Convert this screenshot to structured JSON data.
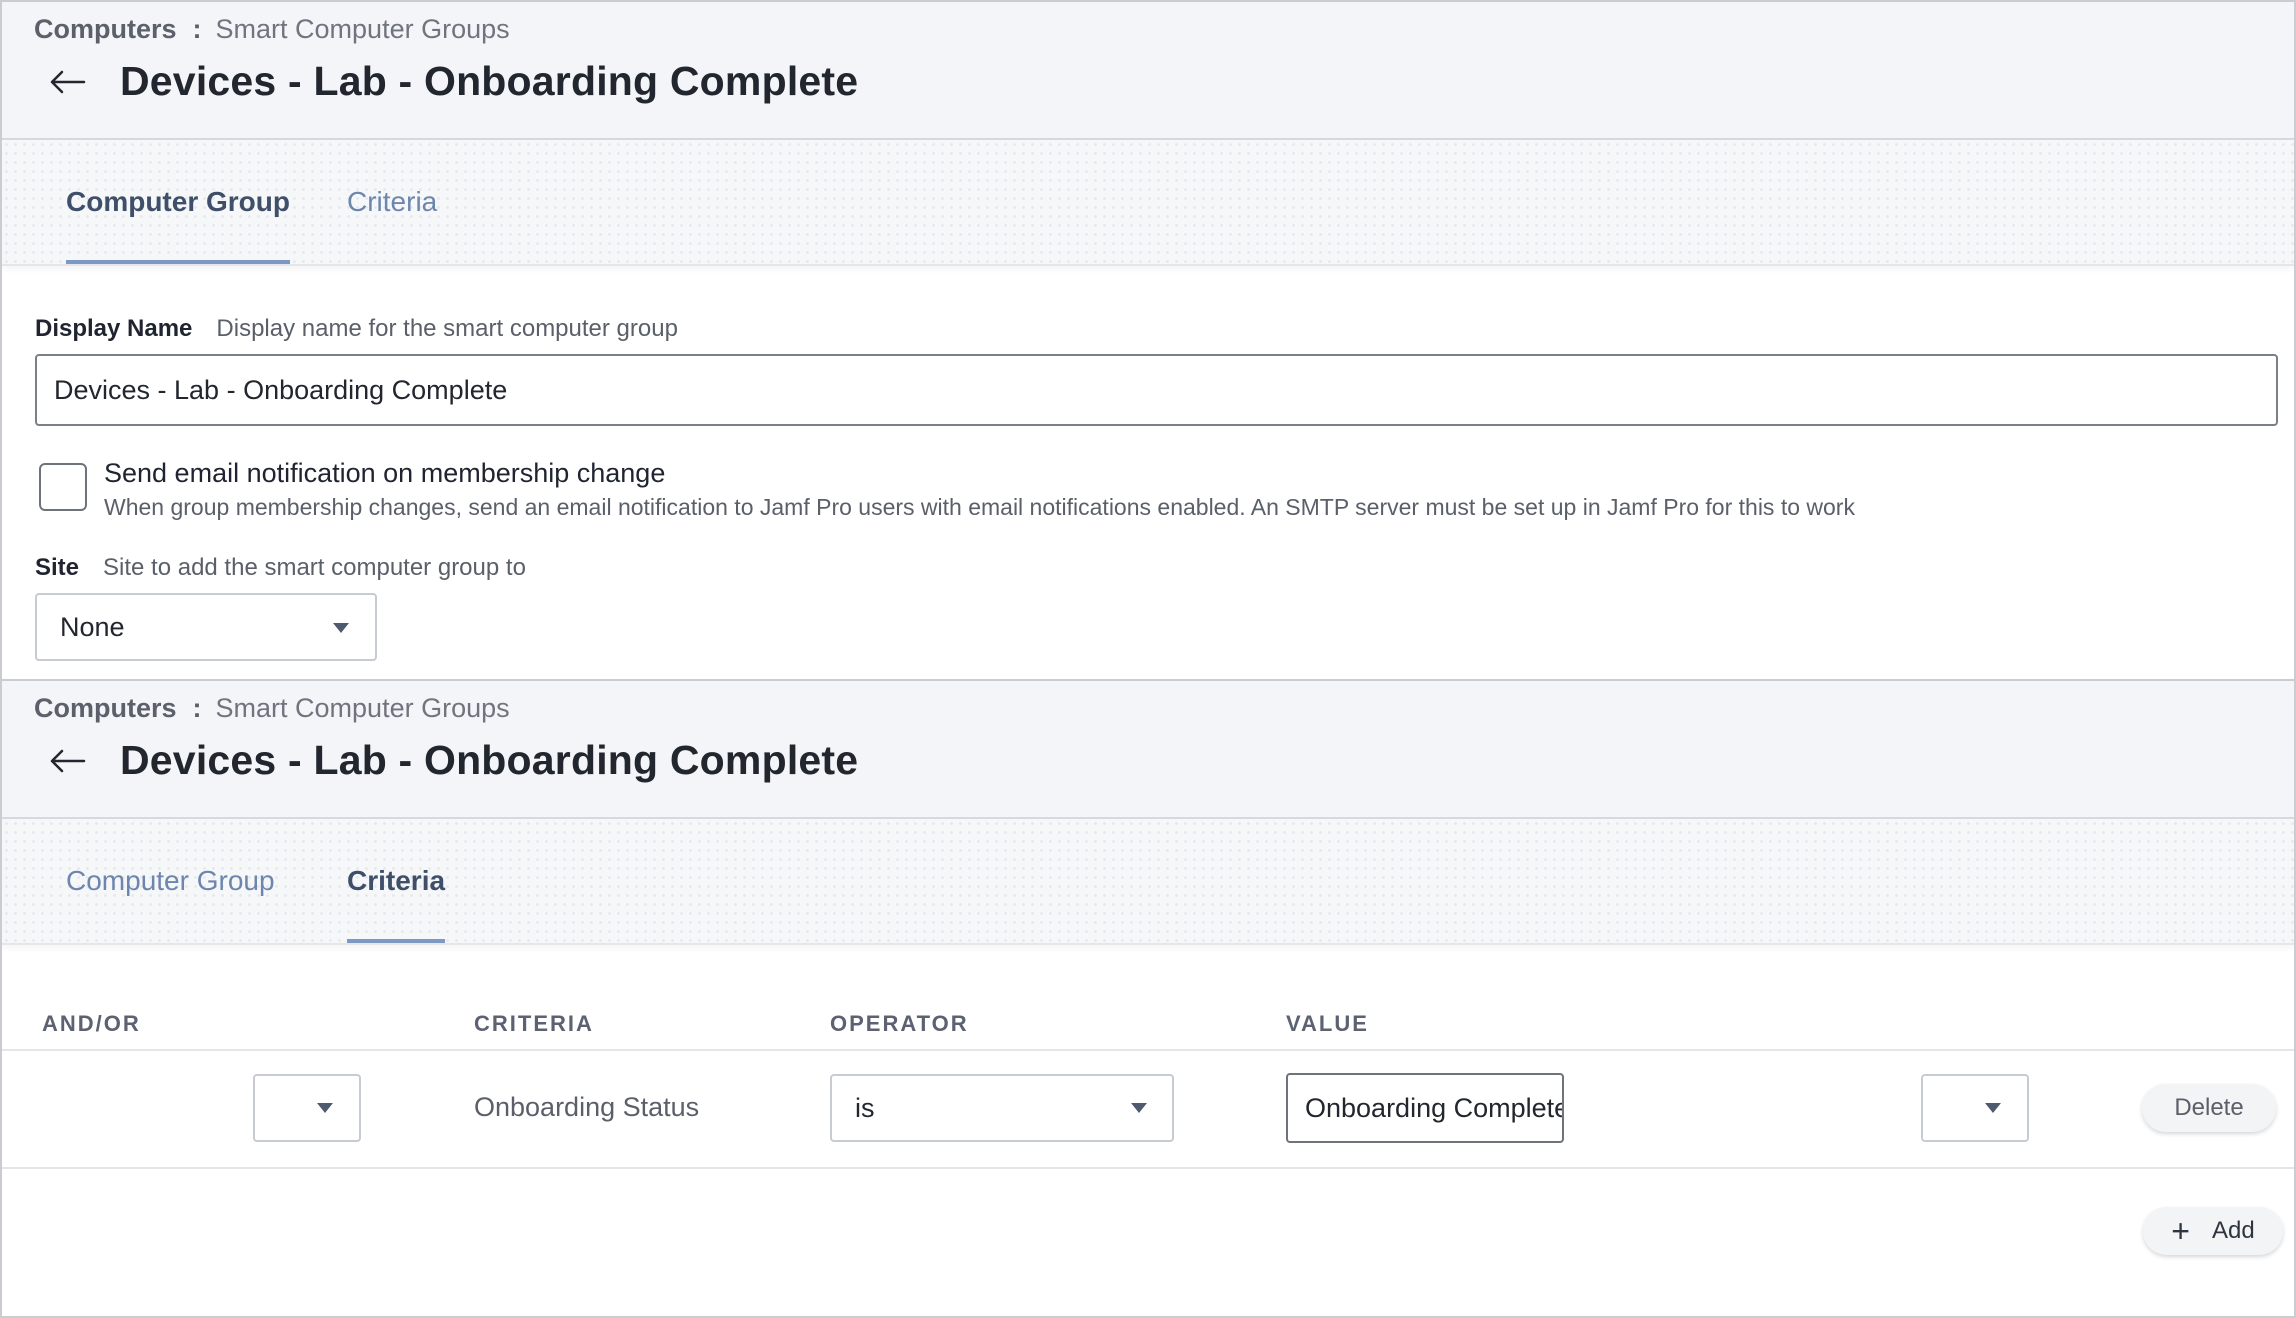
{
  "screen_1": {
    "breadcrumb": {
      "root": "Computers",
      "separator": ":",
      "leaf": "Smart Computer Groups"
    },
    "title": "Devices - Lab - Onboarding Complete",
    "tabs": [
      "Computer Group",
      "Criteria"
    ],
    "active_tab": "Computer Group",
    "display_name": {
      "label": "Display Name",
      "hint": "Display name for the smart computer group",
      "value": "Devices - Lab - Onboarding Complete"
    },
    "email_notification": {
      "title": "Send email notification on membership change",
      "description": "When group membership changes, send an email notification to Jamf Pro users with email notifications enabled. An SMTP server must be set up in Jamf Pro for this to work",
      "checked": false
    },
    "site": {
      "label": "Site",
      "hint": "Site to add the smart computer group to",
      "selected": "None"
    }
  },
  "screen_2": {
    "breadcrumb": {
      "root": "Computers",
      "separator": ":",
      "leaf": "Smart Computer Groups"
    },
    "title": "Devices - Lab - Onboarding Complete",
    "tabs": [
      "Computer Group",
      "Criteria"
    ],
    "active_tab": "Criteria",
    "table": {
      "columns": [
        "AND/OR",
        "CRITERIA",
        "OPERATOR",
        "VALUE"
      ],
      "rows": [
        {
          "and_or": "",
          "criteria": "Onboarding Status",
          "operator": "is",
          "value": "Onboarding Complete",
          "closing_paren": "",
          "delete_label": "Delete"
        }
      ]
    },
    "add_label": "Add"
  },
  "icons": {
    "back": "arrow-left-icon",
    "caret": "caret-down-icon",
    "add": "plus-icon"
  },
  "colors": {
    "accent": "#7d98c4",
    "tab_inactive": "#6d86ad",
    "tab_active": "#3f4f69",
    "header_bg": "#f4f5f9"
  }
}
